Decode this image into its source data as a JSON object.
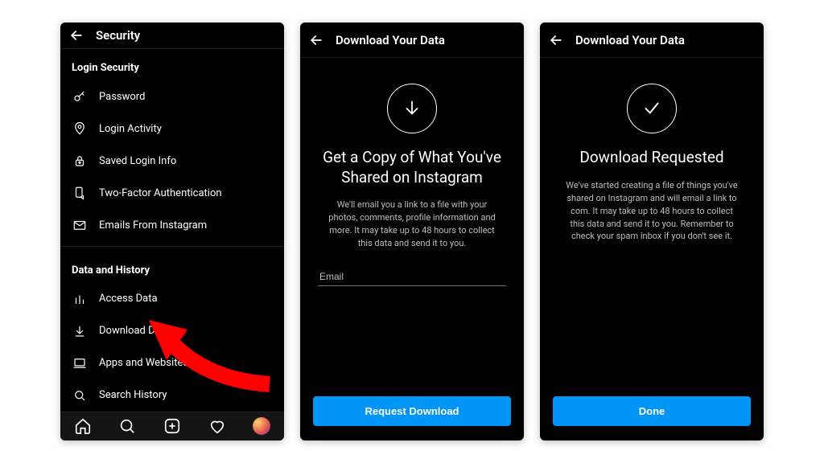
{
  "screen1": {
    "title": "Security",
    "sections": [
      {
        "header": "Login Security",
        "items": [
          {
            "label": "Password",
            "icon": "key-icon"
          },
          {
            "label": "Login Activity",
            "icon": "pin-icon"
          },
          {
            "label": "Saved Login Info",
            "icon": "lock-icon"
          },
          {
            "label": "Two-Factor Authentication",
            "icon": "shield-phone-icon"
          },
          {
            "label": "Emails From Instagram",
            "icon": "envelope-icon"
          }
        ]
      },
      {
        "header": "Data and History",
        "items": [
          {
            "label": "Access Data",
            "icon": "bars-icon"
          },
          {
            "label": "Download Data",
            "icon": "download-icon"
          },
          {
            "label": "Apps and Websites",
            "icon": "laptop-icon"
          },
          {
            "label": "Search History",
            "icon": "search-icon"
          }
        ]
      }
    ]
  },
  "screen2": {
    "title": "Download Your Data",
    "heading": "Get a Copy of What You've Shared on Instagram",
    "body": "We'll email you a link to a file with your photos, comments, profile information and more. It may take up to 48 hours to collect this data and send it to you.",
    "email_placeholder": "Email",
    "button": "Request Download"
  },
  "screen3": {
    "title": "Download Your Data",
    "heading": "Download Requested",
    "body": "We've started creating a file of things you've shared on Instagram and will email a link to com. It may take up to 48 hours to collect this data and send it to you. Remember to check your spam inbox if you don't see it.",
    "button": "Done"
  },
  "annotation": {
    "arrow_target": "Download Data"
  }
}
